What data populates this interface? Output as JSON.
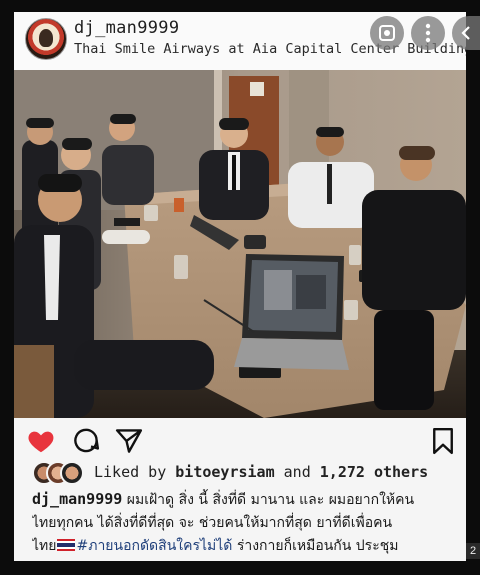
{
  "post": {
    "username": "dj_man9999",
    "location": "Thai Smile Airways at Aia Capital Center Building",
    "liked_by": {
      "prefix": "Liked by ",
      "user": "bitoeyrsiam",
      "middle": " and ",
      "count": "1,272 others"
    },
    "caption": {
      "username": "dj_man9999",
      "line1": " ผมเฝ้าดู สิ่ง นี้ สิ่งที่ดี มานาน และ ผมอยากให้คน",
      "line2": "ไทยทุกคน ได้สิ่งที่ดีที่สุด จะ ช่วยคนให้มากที่สุด ยาที่ดีเพื่อคน",
      "line3_pre": "ไทย",
      "hashtag": "#ภายนอกดัดสินใครไม่ได้",
      "line3_post": " ร่างกายก็เหมือนกัน ประชุม"
    }
  },
  "icons": {
    "like": "heart-icon",
    "comment": "comment-icon",
    "share": "send-icon",
    "save": "bookmark-icon",
    "lens": "lens-icon",
    "more": "more-icon",
    "back": "back-icon"
  },
  "page_indicator": "2",
  "colors": {
    "like": "#e8343d",
    "hashtag": "#1f3f7a"
  }
}
